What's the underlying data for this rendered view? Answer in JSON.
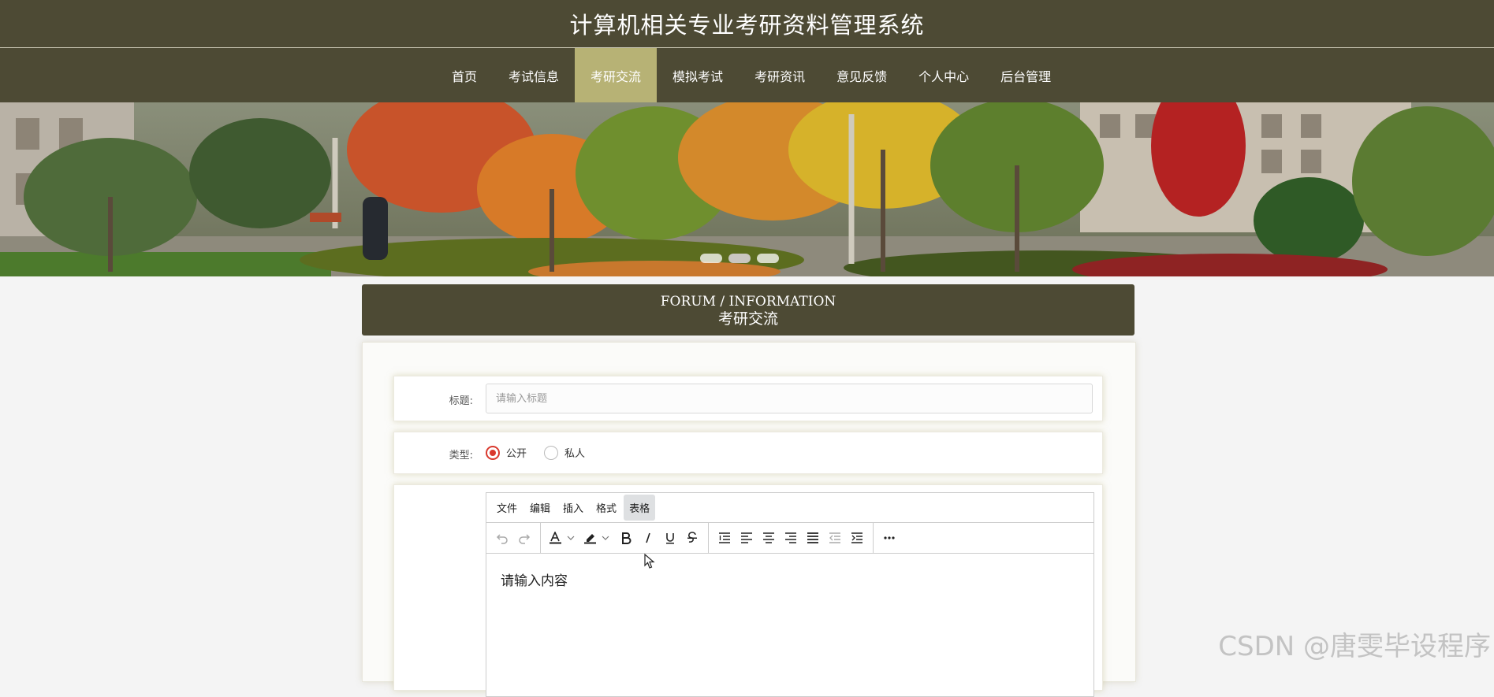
{
  "header": {
    "title": "计算机相关专业考研资料管理系统"
  },
  "nav": {
    "items": [
      {
        "label": "首页"
      },
      {
        "label": "考试信息"
      },
      {
        "label": "考研交流"
      },
      {
        "label": "模拟考试"
      },
      {
        "label": "考研资讯"
      },
      {
        "label": "意见反馈"
      },
      {
        "label": "个人中心"
      },
      {
        "label": "后台管理"
      }
    ],
    "active_index": 2
  },
  "banner": {
    "slide_count": 3,
    "active_slide": 1
  },
  "section": {
    "title_en": "FORUM / INFORMATION",
    "title_cn": "考研交流"
  },
  "form": {
    "title_label": "标题:",
    "title_placeholder": "请输入标题",
    "title_value": "",
    "type_label": "类型:",
    "type_options": [
      {
        "label": "公开",
        "checked": true
      },
      {
        "label": "私人",
        "checked": false
      }
    ]
  },
  "editor": {
    "menu": [
      "文件",
      "编辑",
      "插入",
      "格式",
      "表格"
    ],
    "hovered_menu": "表格",
    "toolbar_icons": [
      "undo-icon",
      "redo-icon",
      "text-color-icon",
      "highlight-color-icon",
      "bold-icon",
      "italic-icon",
      "underline-icon",
      "strikethrough-icon",
      "line-height-icon",
      "align-left-icon",
      "align-center-icon",
      "align-right-icon",
      "align-justify-icon",
      "outdent-icon",
      "indent-icon",
      "more-icon"
    ],
    "placeholder": "请输入内容"
  },
  "watermark": "CSDN @唐雯毕设程序",
  "colors": {
    "header_bg": "#4d4a34",
    "nav_active": "#b7b275",
    "radio_checked": "#d9392e",
    "page_bg": "#f4f4f4"
  }
}
